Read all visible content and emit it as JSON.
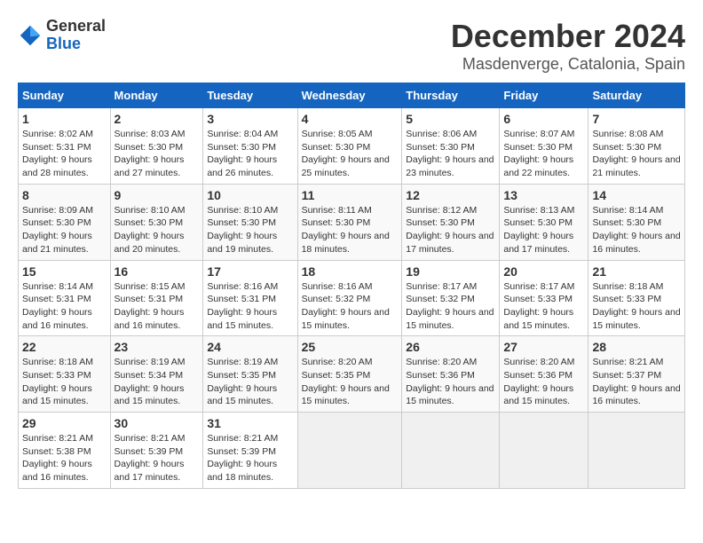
{
  "logo": {
    "text_general": "General",
    "text_blue": "Blue"
  },
  "title": "December 2024",
  "subtitle": "Masdenverge, Catalonia, Spain",
  "days_of_week": [
    "Sunday",
    "Monday",
    "Tuesday",
    "Wednesday",
    "Thursday",
    "Friday",
    "Saturday"
  ],
  "weeks": [
    [
      {
        "day": "1",
        "sunrise": "Sunrise: 8:02 AM",
        "sunset": "Sunset: 5:31 PM",
        "daylight": "Daylight: 9 hours and 28 minutes."
      },
      {
        "day": "2",
        "sunrise": "Sunrise: 8:03 AM",
        "sunset": "Sunset: 5:30 PM",
        "daylight": "Daylight: 9 hours and 27 minutes."
      },
      {
        "day": "3",
        "sunrise": "Sunrise: 8:04 AM",
        "sunset": "Sunset: 5:30 PM",
        "daylight": "Daylight: 9 hours and 26 minutes."
      },
      {
        "day": "4",
        "sunrise": "Sunrise: 8:05 AM",
        "sunset": "Sunset: 5:30 PM",
        "daylight": "Daylight: 9 hours and 25 minutes."
      },
      {
        "day": "5",
        "sunrise": "Sunrise: 8:06 AM",
        "sunset": "Sunset: 5:30 PM",
        "daylight": "Daylight: 9 hours and 23 minutes."
      },
      {
        "day": "6",
        "sunrise": "Sunrise: 8:07 AM",
        "sunset": "Sunset: 5:30 PM",
        "daylight": "Daylight: 9 hours and 22 minutes."
      },
      {
        "day": "7",
        "sunrise": "Sunrise: 8:08 AM",
        "sunset": "Sunset: 5:30 PM",
        "daylight": "Daylight: 9 hours and 21 minutes."
      }
    ],
    [
      {
        "day": "8",
        "sunrise": "Sunrise: 8:09 AM",
        "sunset": "Sunset: 5:30 PM",
        "daylight": "Daylight: 9 hours and 21 minutes."
      },
      {
        "day": "9",
        "sunrise": "Sunrise: 8:10 AM",
        "sunset": "Sunset: 5:30 PM",
        "daylight": "Daylight: 9 hours and 20 minutes."
      },
      {
        "day": "10",
        "sunrise": "Sunrise: 8:10 AM",
        "sunset": "Sunset: 5:30 PM",
        "daylight": "Daylight: 9 hours and 19 minutes."
      },
      {
        "day": "11",
        "sunrise": "Sunrise: 8:11 AM",
        "sunset": "Sunset: 5:30 PM",
        "daylight": "Daylight: 9 hours and 18 minutes."
      },
      {
        "day": "12",
        "sunrise": "Sunrise: 8:12 AM",
        "sunset": "Sunset: 5:30 PM",
        "daylight": "Daylight: 9 hours and 17 minutes."
      },
      {
        "day": "13",
        "sunrise": "Sunrise: 8:13 AM",
        "sunset": "Sunset: 5:30 PM",
        "daylight": "Daylight: 9 hours and 17 minutes."
      },
      {
        "day": "14",
        "sunrise": "Sunrise: 8:14 AM",
        "sunset": "Sunset: 5:30 PM",
        "daylight": "Daylight: 9 hours and 16 minutes."
      }
    ],
    [
      {
        "day": "15",
        "sunrise": "Sunrise: 8:14 AM",
        "sunset": "Sunset: 5:31 PM",
        "daylight": "Daylight: 9 hours and 16 minutes."
      },
      {
        "day": "16",
        "sunrise": "Sunrise: 8:15 AM",
        "sunset": "Sunset: 5:31 PM",
        "daylight": "Daylight: 9 hours and 16 minutes."
      },
      {
        "day": "17",
        "sunrise": "Sunrise: 8:16 AM",
        "sunset": "Sunset: 5:31 PM",
        "daylight": "Daylight: 9 hours and 15 minutes."
      },
      {
        "day": "18",
        "sunrise": "Sunrise: 8:16 AM",
        "sunset": "Sunset: 5:32 PM",
        "daylight": "Daylight: 9 hours and 15 minutes."
      },
      {
        "day": "19",
        "sunrise": "Sunrise: 8:17 AM",
        "sunset": "Sunset: 5:32 PM",
        "daylight": "Daylight: 9 hours and 15 minutes."
      },
      {
        "day": "20",
        "sunrise": "Sunrise: 8:17 AM",
        "sunset": "Sunset: 5:33 PM",
        "daylight": "Daylight: 9 hours and 15 minutes."
      },
      {
        "day": "21",
        "sunrise": "Sunrise: 8:18 AM",
        "sunset": "Sunset: 5:33 PM",
        "daylight": "Daylight: 9 hours and 15 minutes."
      }
    ],
    [
      {
        "day": "22",
        "sunrise": "Sunrise: 8:18 AM",
        "sunset": "Sunset: 5:33 PM",
        "daylight": "Daylight: 9 hours and 15 minutes."
      },
      {
        "day": "23",
        "sunrise": "Sunrise: 8:19 AM",
        "sunset": "Sunset: 5:34 PM",
        "daylight": "Daylight: 9 hours and 15 minutes."
      },
      {
        "day": "24",
        "sunrise": "Sunrise: 8:19 AM",
        "sunset": "Sunset: 5:35 PM",
        "daylight": "Daylight: 9 hours and 15 minutes."
      },
      {
        "day": "25",
        "sunrise": "Sunrise: 8:20 AM",
        "sunset": "Sunset: 5:35 PM",
        "daylight": "Daylight: 9 hours and 15 minutes."
      },
      {
        "day": "26",
        "sunrise": "Sunrise: 8:20 AM",
        "sunset": "Sunset: 5:36 PM",
        "daylight": "Daylight: 9 hours and 15 minutes."
      },
      {
        "day": "27",
        "sunrise": "Sunrise: 8:20 AM",
        "sunset": "Sunset: 5:36 PM",
        "daylight": "Daylight: 9 hours and 15 minutes."
      },
      {
        "day": "28",
        "sunrise": "Sunrise: 8:21 AM",
        "sunset": "Sunset: 5:37 PM",
        "daylight": "Daylight: 9 hours and 16 minutes."
      }
    ],
    [
      {
        "day": "29",
        "sunrise": "Sunrise: 8:21 AM",
        "sunset": "Sunset: 5:38 PM",
        "daylight": "Daylight: 9 hours and 16 minutes."
      },
      {
        "day": "30",
        "sunrise": "Sunrise: 8:21 AM",
        "sunset": "Sunset: 5:39 PM",
        "daylight": "Daylight: 9 hours and 17 minutes."
      },
      {
        "day": "31",
        "sunrise": "Sunrise: 8:21 AM",
        "sunset": "Sunset: 5:39 PM",
        "daylight": "Daylight: 9 hours and 18 minutes."
      },
      null,
      null,
      null,
      null
    ]
  ]
}
